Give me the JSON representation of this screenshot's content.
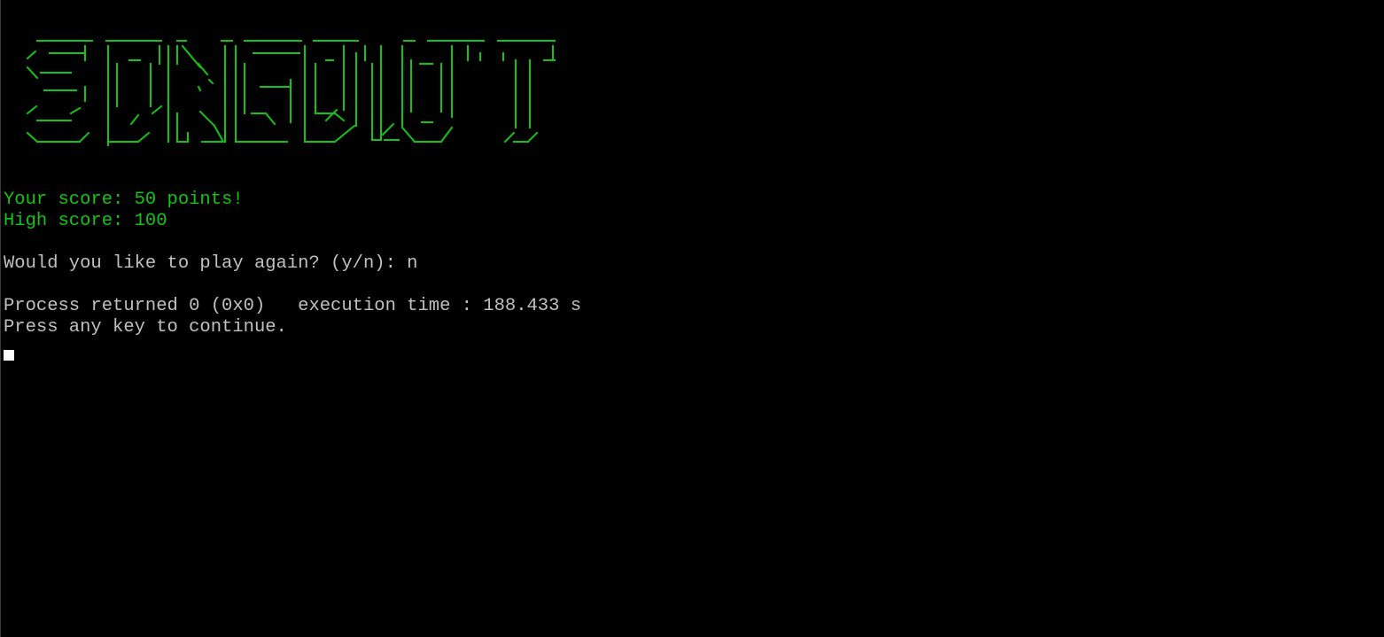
{
  "console": {
    "banner_text": "SONGDIOT",
    "score_line": "Your score: 50 points!",
    "high_score_line": "High score: 100",
    "prompt_line": "Would you like to play again? (y/n): n",
    "process_line": "Process returned 0 (0x0)   execution time : 188.433 s",
    "press_line": "Press any key to continue."
  },
  "colors": {
    "background": "#000000",
    "accent_green": "#13c413",
    "text_grey": "#c0c0c0",
    "cursor": "#ffffff"
  }
}
